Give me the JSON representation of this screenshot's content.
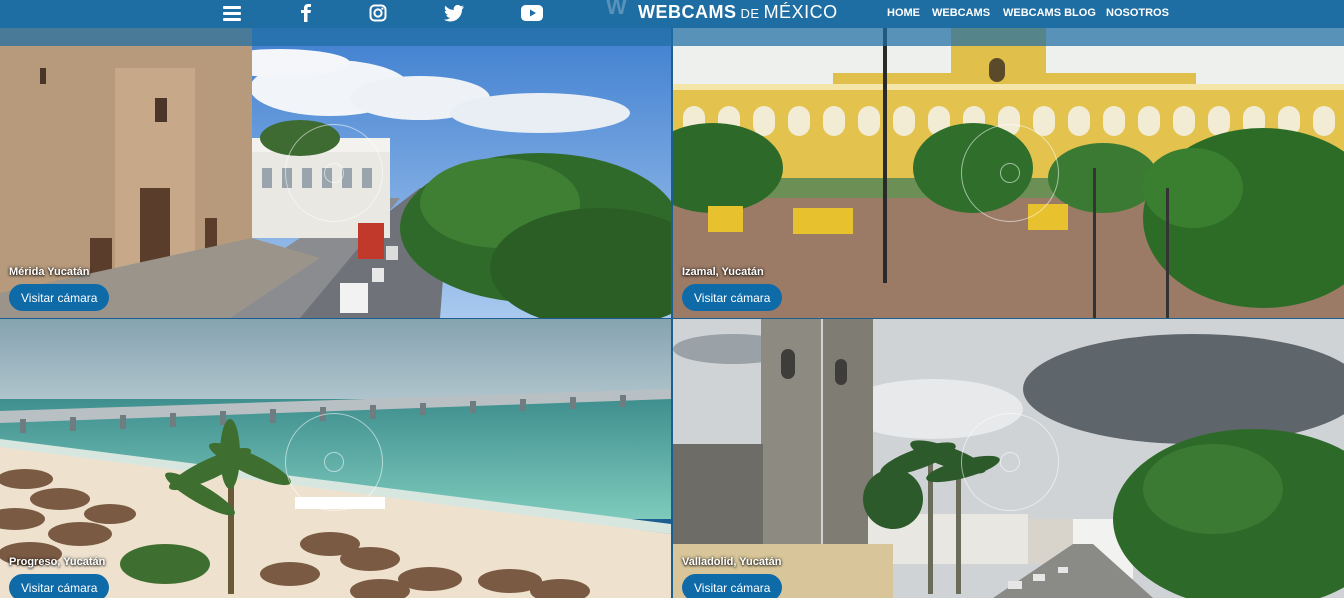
{
  "header": {
    "brand": {
      "bold": "WEBCAMS",
      "middle": "DE",
      "end": "MÉXICO",
      "ghost": "W"
    },
    "icons": [
      "menu-icon",
      "facebook-icon",
      "instagram-icon",
      "twitter-icon",
      "youtube-icon"
    ],
    "nav": [
      "HOME",
      "WEBCAMS",
      "WEBCAMS BLOG",
      "NOSOTROS"
    ],
    "colors": {
      "bar": "#1f6ea3",
      "button": "#0f6aa8"
    }
  },
  "tiles": [
    {
      "title": "Mérida Yucatán",
      "button": "Visitar cámara"
    },
    {
      "title": "Izamal, Yucatán",
      "button": "Visitar cámara"
    },
    {
      "title": "Progreso, Yucatán",
      "button": "Visitar cámara"
    },
    {
      "title": "Valladolid, Yucatán",
      "button": "Visitar cámara"
    }
  ]
}
